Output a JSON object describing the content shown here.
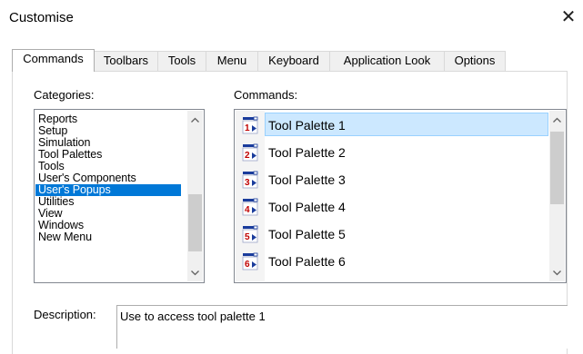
{
  "window": {
    "title": "Customise",
    "close_glyph": "✕"
  },
  "tabs": [
    {
      "label": "Commands",
      "active": true
    },
    {
      "label": "Toolbars",
      "active": false
    },
    {
      "label": "Tools",
      "active": false
    },
    {
      "label": "Menu",
      "active": false
    },
    {
      "label": "Keyboard",
      "active": false
    },
    {
      "label": "Application Look",
      "active": false
    },
    {
      "label": "Options",
      "active": false
    }
  ],
  "categories": {
    "label": "Categories:",
    "items": [
      {
        "label": "Reports"
      },
      {
        "label": "Setup"
      },
      {
        "label": "Simulation"
      },
      {
        "label": "Tool Palettes"
      },
      {
        "label": "Tools"
      },
      {
        "label": "User's Components"
      },
      {
        "label": "User's Popups",
        "selected": true
      },
      {
        "label": "Utilities"
      },
      {
        "label": "View"
      },
      {
        "label": "Windows"
      },
      {
        "label": "New Menu"
      }
    ]
  },
  "commands": {
    "label": "Commands:",
    "items": [
      {
        "label": "Tool Palette 1",
        "number": "1",
        "selected": true
      },
      {
        "label": "Tool Palette 2",
        "number": "2"
      },
      {
        "label": "Tool Palette 3",
        "number": "3"
      },
      {
        "label": "Tool Palette 4",
        "number": "4"
      },
      {
        "label": "Tool Palette 5",
        "number": "5"
      },
      {
        "label": "Tool Palette 6",
        "number": "6"
      }
    ]
  },
  "description": {
    "label": "Description:",
    "text": "Use to access tool palette 1"
  },
  "colors": {
    "selection": "#0078d7",
    "command_selection": "#cce8ff",
    "palette_icon_blue": "#1a3c9c",
    "palette_icon_red": "#c00000"
  },
  "icons": {
    "scroll_up": "chevron-up-icon",
    "scroll_down": "chevron-down-icon",
    "command_icon": "tool-palette-icon"
  }
}
